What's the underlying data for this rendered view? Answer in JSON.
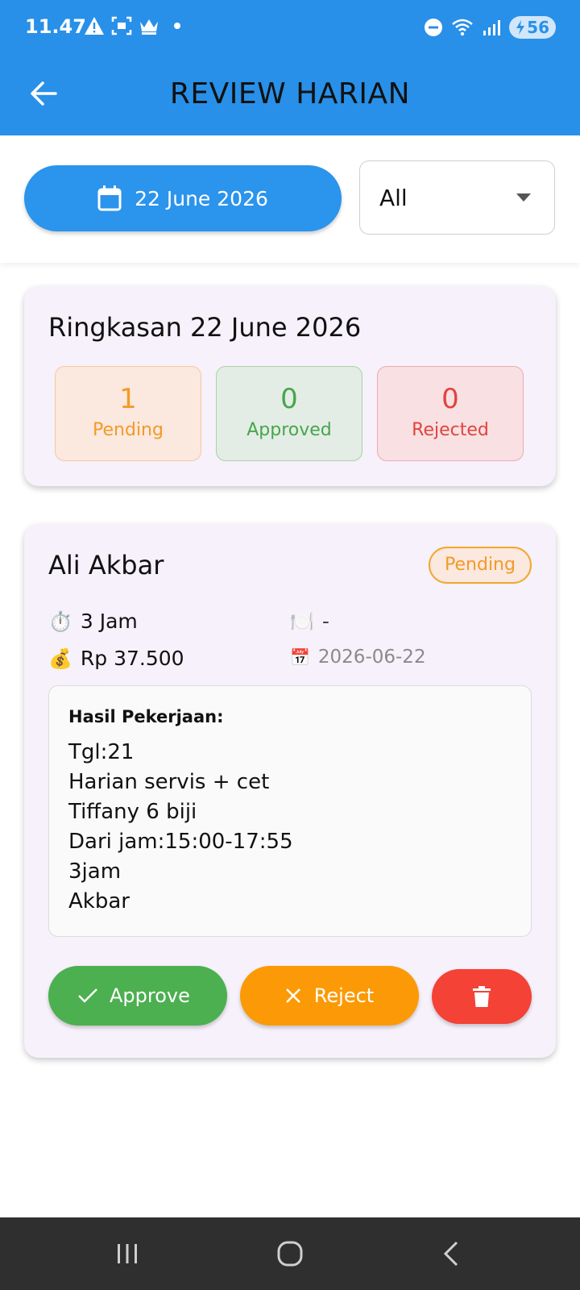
{
  "status_bar": {
    "time": "11.47",
    "battery_level": "56",
    "icons_left": [
      "warning-icon",
      "screenshot-icon",
      "crown-icon",
      "notification-dot"
    ],
    "icons_right": [
      "do-not-disturb-icon",
      "wifi-icon",
      "signal-icon",
      "battery-charging-icon"
    ]
  },
  "app_bar": {
    "title": "REVIEW HARIAN",
    "back_icon": "arrow-left-icon"
  },
  "filters": {
    "date_label": "22 June 2026",
    "status_selected": "All"
  },
  "summary": {
    "title": "Ringkasan 22 June 2026",
    "stats": [
      {
        "value": "1",
        "label": "Pending",
        "color": "#f39a28"
      },
      {
        "value": "0",
        "label": "Approved",
        "color": "#46a64a"
      },
      {
        "value": "0",
        "label": "Rejected",
        "color": "#e0443c"
      }
    ]
  },
  "entries": [
    {
      "name": "Ali Akbar",
      "status": "Pending",
      "hours": "3 Jam",
      "meal": "-",
      "pay": "Rp 37.500",
      "date": "2026-06-22",
      "result_label": "Hasil Pekerjaan:",
      "result_lines": [
        "Tgl:21",
        "Harian servis + cet",
        "Tiffany 6 biji",
        "Dari jam:15:00-17:55",
        "3jam",
        "Akbar"
      ],
      "actions": {
        "approve_label": "Approve",
        "reject_label": "Reject"
      }
    }
  ],
  "colors": {
    "primary": "#2890e8",
    "approve": "#4caf50",
    "reject": "#fb9a06",
    "delete": "#f44236"
  }
}
